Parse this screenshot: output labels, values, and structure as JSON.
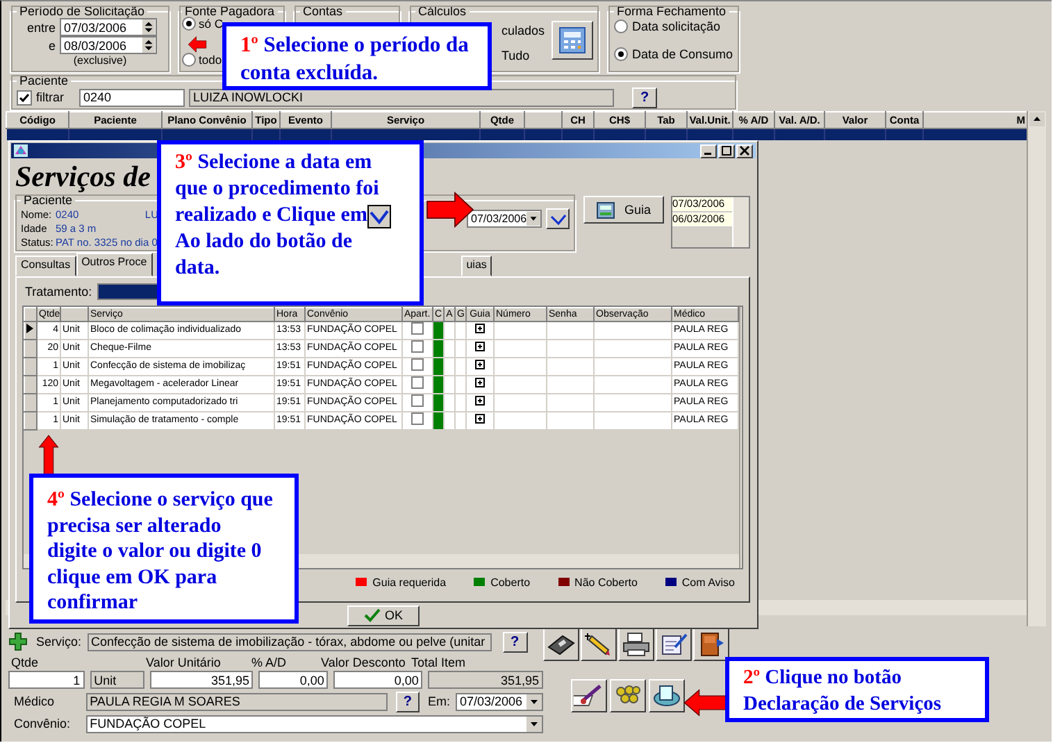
{
  "filter_panel": {
    "period": {
      "title": "Período de Solicitação",
      "from_label": "entre",
      "from": "07/03/2006",
      "to_label": "e",
      "to": "08/03/2006",
      "note": "(exclusive)"
    },
    "payer": {
      "title": "Fonte Pagadora",
      "options": [
        {
          "label": "só C",
          "selected": true
        },
        {
          "label": "todo",
          "selected": false
        }
      ]
    },
    "accounts": {
      "title": "Contas"
    },
    "calculations": {
      "title": "Cálculos",
      "options": [
        "culados",
        "Tudo"
      ]
    },
    "closing": {
      "title": "Forma Fechamento",
      "options": [
        {
          "label": "Data solicitação",
          "selected": false
        },
        {
          "label": "Data de Consumo",
          "selected": true
        }
      ]
    },
    "patient": {
      "title": "Paciente",
      "filter_label": "filtrar",
      "filter_checked": true,
      "code": "0240",
      "name": "LUIZA INOWLOCKI",
      "help": "?"
    }
  },
  "main_grid": {
    "columns": [
      "Código",
      "Paciente",
      "Plano Convênio",
      "Tipo",
      "Evento",
      "Serviço",
      "Qtde",
      "CH",
      "CH$",
      "Tab",
      "Val.Unit.",
      "% A/D",
      "Val. A/D.",
      "Valor",
      "Conta",
      "M"
    ]
  },
  "dialog": {
    "heading": "Serviços de",
    "patient": {
      "title": "Paciente",
      "fields": [
        {
          "label": "Nome:",
          "value": "0240",
          "extra": "LU"
        },
        {
          "label": "Idade",
          "value": "59 a 3 m"
        },
        {
          "label": "Status:",
          "value": "PAT no. 3325 no dia 0"
        }
      ]
    },
    "date": "07/03/2006",
    "guia_button": "Guia",
    "dates": [
      "07/03/2006",
      "06/03/2006"
    ],
    "tabs": [
      {
        "label": "Consultas",
        "selected": false
      },
      {
        "label": "Outros Proce",
        "selected": true
      },
      {
        "label": "uias",
        "selected": false
      }
    ],
    "treatment_label": "Tratamento:",
    "grid": {
      "columns": [
        "Qtde",
        "Serviço",
        "Hora",
        "Convênio",
        "Apart.",
        "C",
        "A",
        "G",
        "Guia",
        "Número",
        "Senha",
        "Observação",
        "Médico"
      ],
      "rows": [
        {
          "qtde": "4",
          "unit": "Unit",
          "service": "Bloco de colimação individualizado",
          "time": "13:53",
          "plan": "FUNDAÇÃO COPEL",
          "apart": false,
          "color": "#008000",
          "doctor": "PAULA REG",
          "selected": true
        },
        {
          "qtde": "20",
          "unit": "Unit",
          "service": "Cheque-Filme",
          "time": "13:53",
          "plan": "FUNDAÇÃO COPEL",
          "apart": false,
          "color": "#008000",
          "doctor": "PAULA REG",
          "selected": false
        },
        {
          "qtde": "1",
          "unit": "Unit",
          "service": "Confecção de sistema de imobilizaç",
          "time": "19:51",
          "plan": "FUNDAÇÃO COPEL",
          "apart": false,
          "color": "#008000",
          "doctor": "PAULA REG",
          "selected": false
        },
        {
          "qtde": "120",
          "unit": "Unit",
          "service": "Megavoltagem - acelerador Linear",
          "time": "19:51",
          "plan": "FUNDAÇÃO COPEL",
          "apart": false,
          "color": "#008000",
          "doctor": "PAULA REG",
          "selected": false
        },
        {
          "qtde": "1",
          "unit": "Unit",
          "service": "Planejamento computadorizado tri",
          "time": "19:51",
          "plan": "FUNDAÇÃO COPEL",
          "apart": false,
          "color": "#008000",
          "doctor": "PAULA REG",
          "selected": false
        },
        {
          "qtde": "1",
          "unit": "Unit",
          "service": "Simulação de tratamento - comple",
          "time": "19:51",
          "plan": "FUNDAÇÃO COPEL",
          "apart": false,
          "color": "#008000",
          "doctor": "PAULA REG",
          "selected": false
        }
      ]
    },
    "legend": [
      {
        "label": "Guia requerida",
        "color": "#ff0000"
      },
      {
        "label": "Coberto",
        "color": "#008000"
      },
      {
        "label": "Não Coberto",
        "color": "#800000"
      },
      {
        "label": "Com Aviso",
        "color": "#000080"
      }
    ],
    "ok_button": "OK"
  },
  "item_form": {
    "service_label": "Serviço:",
    "service": "Confecção de sistema de imobilização - tórax, abdome ou pelve (unitar",
    "help": "?",
    "qty_label": "Qtde",
    "qty": "1",
    "unit": "Unit",
    "unit_price_label": "Valor Unitário",
    "unit_price": "351,95",
    "discount_pct_label": "% A/D",
    "discount_pct": "0,00",
    "discount_label": "Valor Desconto",
    "discount": "0,00",
    "total_label": "Total Item",
    "total": "351,95",
    "doctor_label": "Médico",
    "doctor": "PAULA REGIA M SOARES",
    "doctor_help": "?",
    "date_label": "Em:",
    "date": "07/03/2006",
    "plan_label": "Convênio:",
    "plan": "FUNDAÇÃO COPEL"
  },
  "callouts": [
    {
      "number": "1º",
      "text": "Selecione o período da conta excluída."
    },
    {
      "number": "3º",
      "text": "Selecione a data em que o procedimento foi realizado e Clique em",
      "text_after": "Ao lado do botão de data."
    },
    {
      "number": "4º",
      "text": "Selecione o serviço que precisa ser alterado digite o valor ou digite 0 clique em OK para confirmar"
    },
    {
      "number": "2º",
      "text": "Clique no botão Declaração de Serviços"
    }
  ]
}
